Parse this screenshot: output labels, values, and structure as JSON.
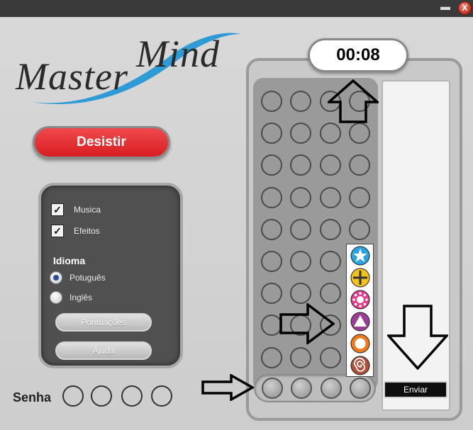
{
  "titlebar": {
    "minimize_label": "▬",
    "close_label": "X"
  },
  "logo": {
    "text": "MasterMind",
    "accent_color": "#2e9bd6"
  },
  "actions": {
    "desistir_label": "Desistir"
  },
  "options": {
    "musica": {
      "label": "Musica",
      "checked": true
    },
    "efeitos": {
      "label": "Efeitos",
      "checked": true
    },
    "idioma_heading": "Idioma",
    "languages": [
      {
        "label": "Potuguês",
        "selected": true
      },
      {
        "label": "Inglês",
        "selected": false
      }
    ],
    "pontuacoes_label": "Pontuações",
    "ajuda_label": "Ajuda",
    "check_mark": "✓"
  },
  "senha": {
    "label": "Senha",
    "slots": 4
  },
  "timer": {
    "value": "00:08"
  },
  "board": {
    "rows": 9,
    "columns": 4
  },
  "palette": {
    "pegs": [
      {
        "name": "star",
        "color": "#2ba3e0"
      },
      {
        "name": "plus",
        "color": "#f2c21a"
      },
      {
        "name": "sun",
        "color": "#e43d8f"
      },
      {
        "name": "triangle",
        "color": "#9a3f95"
      },
      {
        "name": "ring",
        "color": "#f07a1c"
      },
      {
        "name": "spiral",
        "color": "#b0503a"
      }
    ]
  },
  "enviar_label": "Enviar"
}
